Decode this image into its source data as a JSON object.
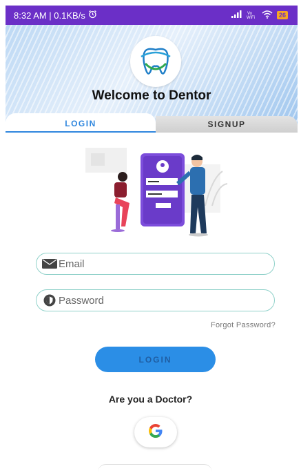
{
  "status_bar": {
    "time_speed": "8:32 AM | 0.1KB/s",
    "alarm_icon": "alarm-icon",
    "battery": "26",
    "colors": {
      "background": "#6b2fc7"
    }
  },
  "header": {
    "title": "Welcome to Dentor",
    "logo_icon": "tooth-logo-icon"
  },
  "tabs": {
    "login": "LOGIN",
    "signup": "SIGNUP",
    "active": "login"
  },
  "form": {
    "email": {
      "placeholder": "Email",
      "value": "",
      "icon": "mail-icon"
    },
    "password": {
      "placeholder": "Password",
      "value": "",
      "icon": "shield-icon"
    },
    "forgot": "Forgot Password?",
    "login_button": "LOGIN"
  },
  "doctor_prompt": "Are you a Doctor?",
  "google": {
    "icon": "google-icon"
  },
  "colors": {
    "accent": "#2b8ee6",
    "field_border": "#8fd1c9",
    "illustration_purple": "#7c4ddb"
  }
}
